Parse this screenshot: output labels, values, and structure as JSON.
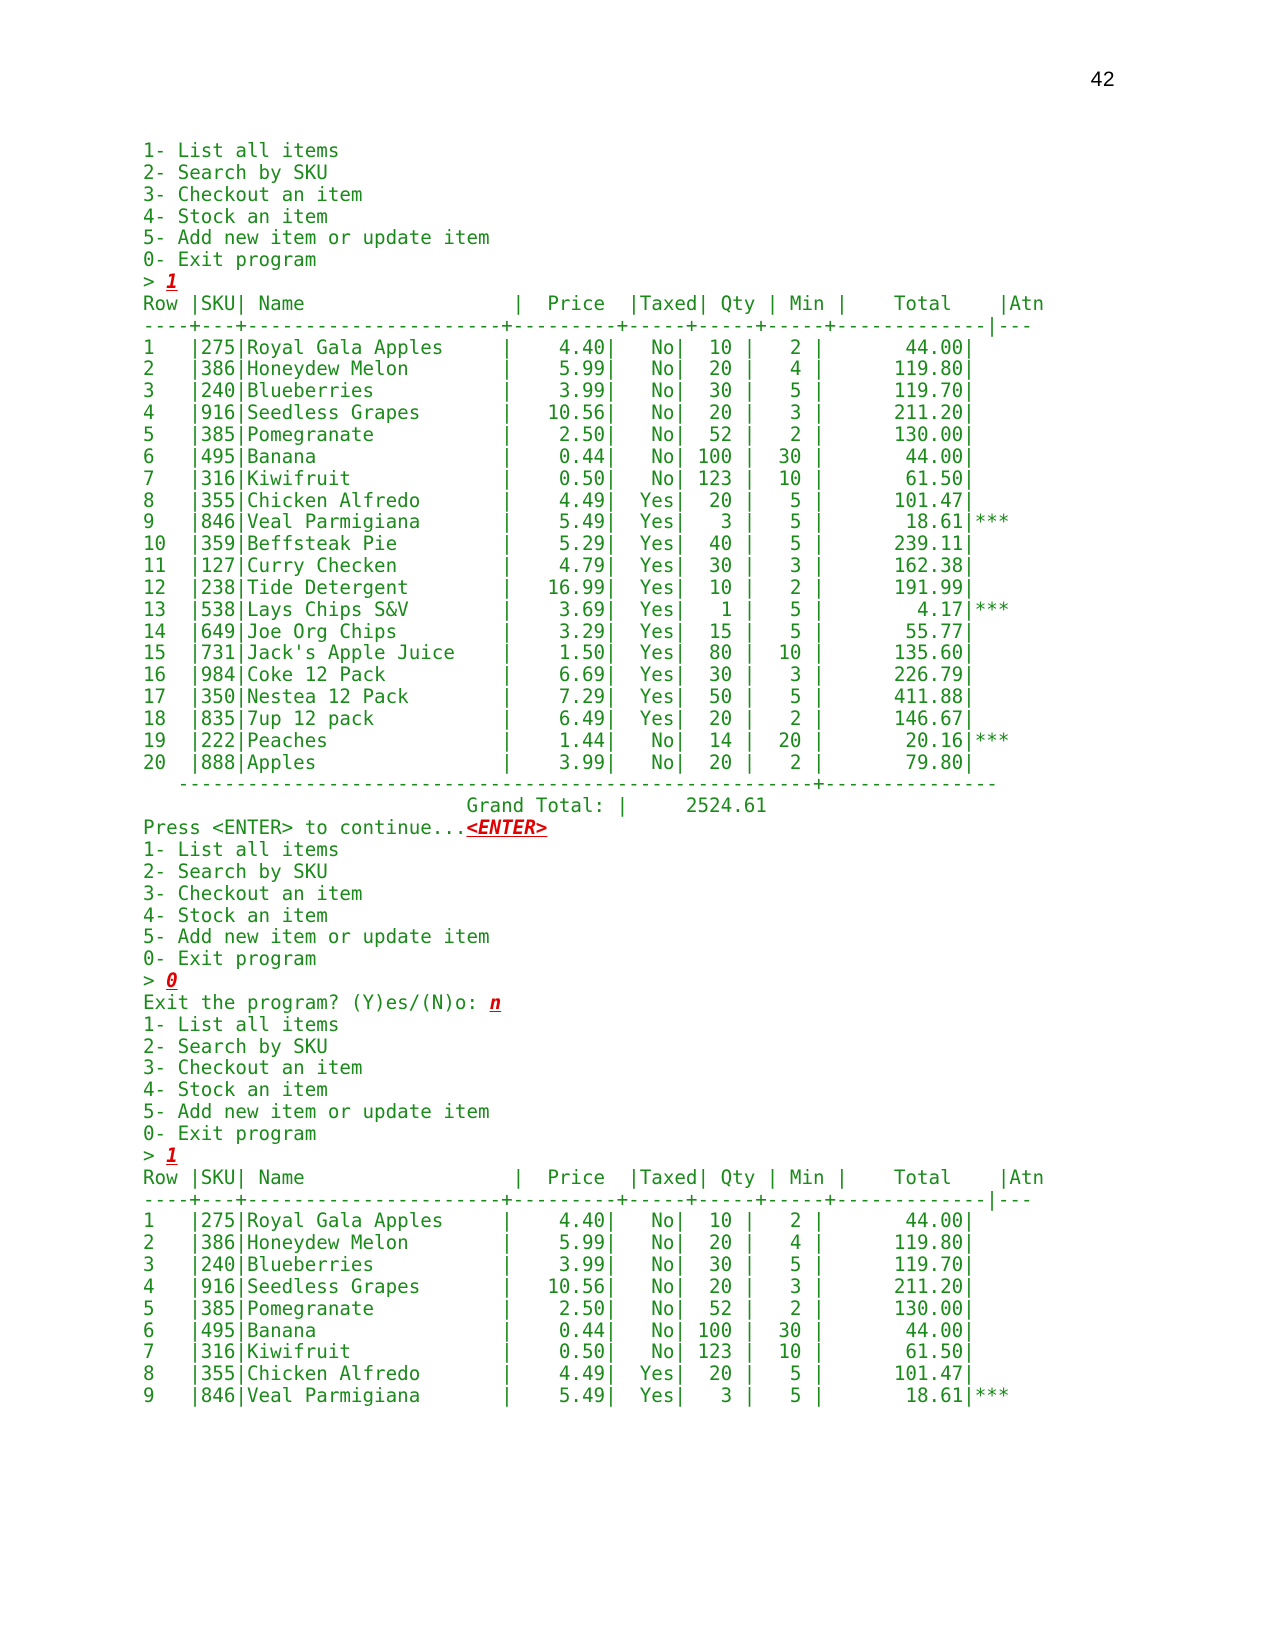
{
  "page": {
    "number": "42"
  },
  "terminal": {
    "menu": [
      "1- List all items",
      "2- Search by SKU",
      "3- Checkout an item",
      "4- Stock an item",
      "5- Add new item or update item",
      "0- Exit program"
    ],
    "prompt_symbol": "> ",
    "inputs": {
      "list_items": "1",
      "enter_key": "<ENTER>",
      "exit_choice": "0",
      "exit_confirm": "n"
    },
    "press_enter_label": "Press <ENTER> to continue...",
    "exit_prompt_label": "Exit the program? (Y)es/(N)o: ",
    "grand_total_label": "Grand Total: |",
    "grand_total_value": "2524.61",
    "colors": {
      "output_green": "#1a8a1a",
      "input_red": "#e00000",
      "page_number_black": "#000000"
    }
  },
  "table": {
    "headers": [
      "Row",
      "SKU",
      "Name",
      "Price",
      "Taxed",
      "Qty",
      "Min",
      "Total",
      "Atn"
    ],
    "header_line": "Row |SKU| Name                  |  Price  |Taxed| Qty | Min |    Total    |Atn",
    "separator_line": "----+---+----------------------+---------+-----+-----+-----+-------------|---",
    "footer_line": "   -------------------------------------------------------+---------------",
    "attention_marker": "***",
    "rows": [
      {
        "row": "1",
        "sku": "275",
        "name": "Royal Gala Apples",
        "price": "4.40",
        "taxed": "No",
        "qty": "10",
        "min": "2",
        "total": "44.00",
        "atn": ""
      },
      {
        "row": "2",
        "sku": "386",
        "name": "Honeydew Melon",
        "price": "5.99",
        "taxed": "No",
        "qty": "20",
        "min": "4",
        "total": "119.80",
        "atn": ""
      },
      {
        "row": "3",
        "sku": "240",
        "name": "Blueberries",
        "price": "3.99",
        "taxed": "No",
        "qty": "30",
        "min": "5",
        "total": "119.70",
        "atn": ""
      },
      {
        "row": "4",
        "sku": "916",
        "name": "Seedless Grapes",
        "price": "10.56",
        "taxed": "No",
        "qty": "20",
        "min": "3",
        "total": "211.20",
        "atn": ""
      },
      {
        "row": "5",
        "sku": "385",
        "name": "Pomegranate",
        "price": "2.50",
        "taxed": "No",
        "qty": "52",
        "min": "2",
        "total": "130.00",
        "atn": ""
      },
      {
        "row": "6",
        "sku": "495",
        "name": "Banana",
        "price": "0.44",
        "taxed": "No",
        "qty": "100",
        "min": "30",
        "total": "44.00",
        "atn": ""
      },
      {
        "row": "7",
        "sku": "316",
        "name": "Kiwifruit",
        "price": "0.50",
        "taxed": "No",
        "qty": "123",
        "min": "10",
        "total": "61.50",
        "atn": ""
      },
      {
        "row": "8",
        "sku": "355",
        "name": "Chicken Alfredo",
        "price": "4.49",
        "taxed": "Yes",
        "qty": "20",
        "min": "5",
        "total": "101.47",
        "atn": ""
      },
      {
        "row": "9",
        "sku": "846",
        "name": "Veal Parmigiana",
        "price": "5.49",
        "taxed": "Yes",
        "qty": "3",
        "min": "5",
        "total": "18.61",
        "atn": "***"
      },
      {
        "row": "10",
        "sku": "359",
        "name": "Beffsteak Pie",
        "price": "5.29",
        "taxed": "Yes",
        "qty": "40",
        "min": "5",
        "total": "239.11",
        "atn": ""
      },
      {
        "row": "11",
        "sku": "127",
        "name": "Curry Checken",
        "price": "4.79",
        "taxed": "Yes",
        "qty": "30",
        "min": "3",
        "total": "162.38",
        "atn": ""
      },
      {
        "row": "12",
        "sku": "238",
        "name": "Tide Detergent",
        "price": "16.99",
        "taxed": "Yes",
        "qty": "10",
        "min": "2",
        "total": "191.99",
        "atn": ""
      },
      {
        "row": "13",
        "sku": "538",
        "name": "Lays Chips S&V",
        "price": "3.69",
        "taxed": "Yes",
        "qty": "1",
        "min": "5",
        "total": "4.17",
        "atn": "***"
      },
      {
        "row": "14",
        "sku": "649",
        "name": "Joe Org Chips",
        "price": "3.29",
        "taxed": "Yes",
        "qty": "15",
        "min": "5",
        "total": "55.77",
        "atn": ""
      },
      {
        "row": "15",
        "sku": "731",
        "name": "Jack's Apple Juice",
        "price": "1.50",
        "taxed": "Yes",
        "qty": "80",
        "min": "10",
        "total": "135.60",
        "atn": ""
      },
      {
        "row": "16",
        "sku": "984",
        "name": "Coke 12 Pack",
        "price": "6.69",
        "taxed": "Yes",
        "qty": "30",
        "min": "3",
        "total": "226.79",
        "atn": ""
      },
      {
        "row": "17",
        "sku": "350",
        "name": "Nestea 12 Pack",
        "price": "7.29",
        "taxed": "Yes",
        "qty": "50",
        "min": "5",
        "total": "411.88",
        "atn": ""
      },
      {
        "row": "18",
        "sku": "835",
        "name": "7up 12 pack",
        "price": "6.49",
        "taxed": "Yes",
        "qty": "20",
        "min": "2",
        "total": "146.67",
        "atn": ""
      },
      {
        "row": "19",
        "sku": "222",
        "name": "Peaches",
        "price": "1.44",
        "taxed": "No",
        "qty": "14",
        "min": "20",
        "total": "20.16",
        "atn": "***"
      },
      {
        "row": "20",
        "sku": "888",
        "name": "Apples",
        "price": "3.99",
        "taxed": "No",
        "qty": "20",
        "min": "2",
        "total": "79.80",
        "atn": ""
      }
    ],
    "second_table_visible_row_count": 9
  }
}
